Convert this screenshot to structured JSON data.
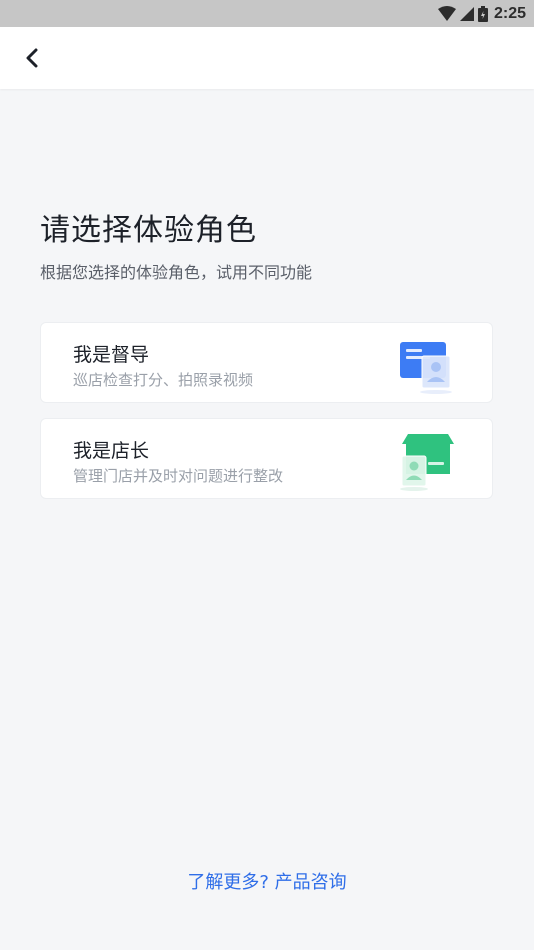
{
  "status_bar": {
    "time": "2:25",
    "icons": [
      "wifi-icon",
      "signal-icon",
      "battery-icon"
    ]
  },
  "app_bar": {
    "back_icon": "chevron-left-icon"
  },
  "page": {
    "title": "请选择体验角色",
    "subtitle": "根据您选择的体验角色，试用不同功能"
  },
  "roles": [
    {
      "title": "我是督导",
      "description": "巡店检查打分、拍照录视频",
      "icon": "supervisor-icon",
      "icon_color": "#3d7cf4"
    },
    {
      "title": "我是店长",
      "description": "管理门店并及时对问题进行整改",
      "icon": "store-icon",
      "icon_color": "#2fc27f"
    }
  ],
  "footer": {
    "link_label": "了解更多? 产品咨询",
    "link_color": "#2f6ee8"
  }
}
